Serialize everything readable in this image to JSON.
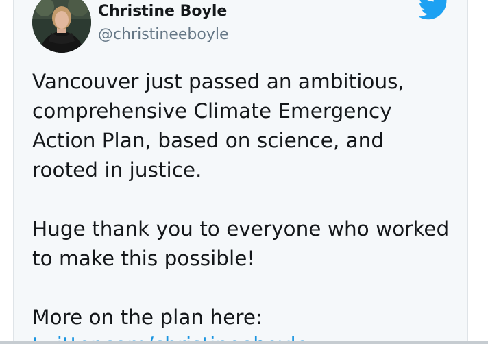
{
  "tweet": {
    "author": {
      "display_name": "Christine Boyle",
      "handle": "@christineeboyle"
    },
    "paragraphs": [
      [
        "Vancouver just passed an ambitious,",
        "comprehensive Climate Emergency",
        "Action Plan, based on science, and",
        "rooted in justice."
      ],
      [
        "Huge thank you to everyone who worked",
        "to make this possible!"
      ],
      [
        "More on the plan here:"
      ]
    ],
    "link_partial": "twitter.com/christineeboyle"
  },
  "colors": {
    "brand_blue": "#1da1f2",
    "link_blue": "#1b95e0",
    "card_background": "#f5f8fa",
    "text_primary": "#14171a",
    "text_secondary": "#657786"
  },
  "icons": {
    "logo": "twitter-bird-icon",
    "avatar": "profile-photo"
  }
}
